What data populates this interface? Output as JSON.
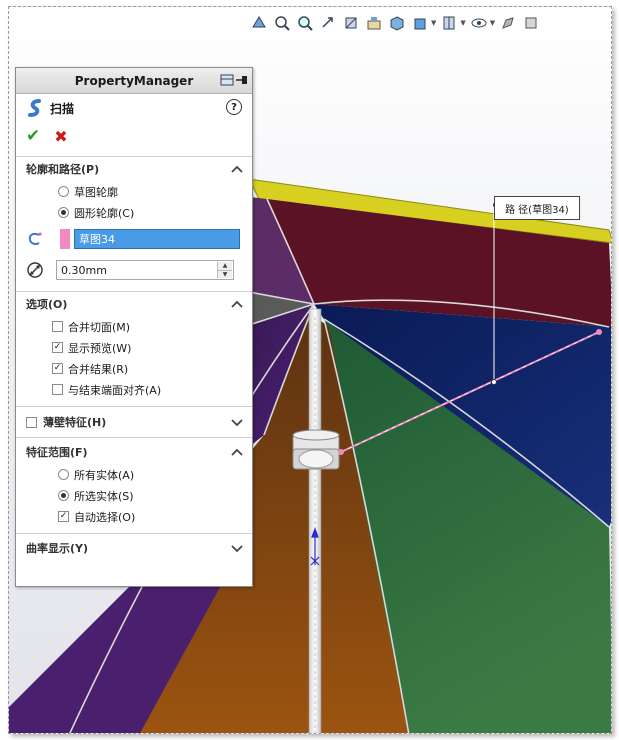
{
  "panel": {
    "title": "PropertyManager",
    "feature_name": "扫描",
    "help_label": "?",
    "ok_label": "✔",
    "cancel_label": "✖"
  },
  "profile_path": {
    "header": "轮廓和路径(P)",
    "options": [
      {
        "label": "草图轮廓",
        "selected": false
      },
      {
        "label": "圆形轮廓(C)",
        "selected": true
      }
    ],
    "path_selection": "草图34",
    "diameter": "0.30mm"
  },
  "options_section": {
    "header": "选项(O)",
    "checks": [
      {
        "label": "合并切面(M)",
        "checked": false
      },
      {
        "label": "显示预览(W)",
        "checked": true
      },
      {
        "label": "合并结果(R)",
        "checked": true
      },
      {
        "label": "与结束端面对齐(A)",
        "checked": false
      }
    ]
  },
  "thin_feature": {
    "header": "薄壁特征(H)",
    "checked": false
  },
  "feature_scope": {
    "header": "特征范围(F)",
    "options": [
      {
        "label": "所有实体(A)",
        "selected": false
      },
      {
        "label": "所选实体(S)",
        "selected": true
      }
    ],
    "auto_select": {
      "label": "自动选择(O)",
      "checked": true
    }
  },
  "curvature": {
    "header": "曲率显示(Y)"
  },
  "callout": {
    "label": "路 径(草图34)"
  },
  "colors": {
    "accent_blue": "#4a9be6",
    "ok_green": "#2e9b2e",
    "cancel_red": "#d01818",
    "sketch_pink": "#f08ac0",
    "canopy_yellow": "#d8d020",
    "canopy_red": "#5a1224",
    "canopy_navy": "#0c1f5c",
    "canopy_green": "#356d3c",
    "canopy_brown": "#7a3d12",
    "canopy_purple": "#5c2c66"
  }
}
